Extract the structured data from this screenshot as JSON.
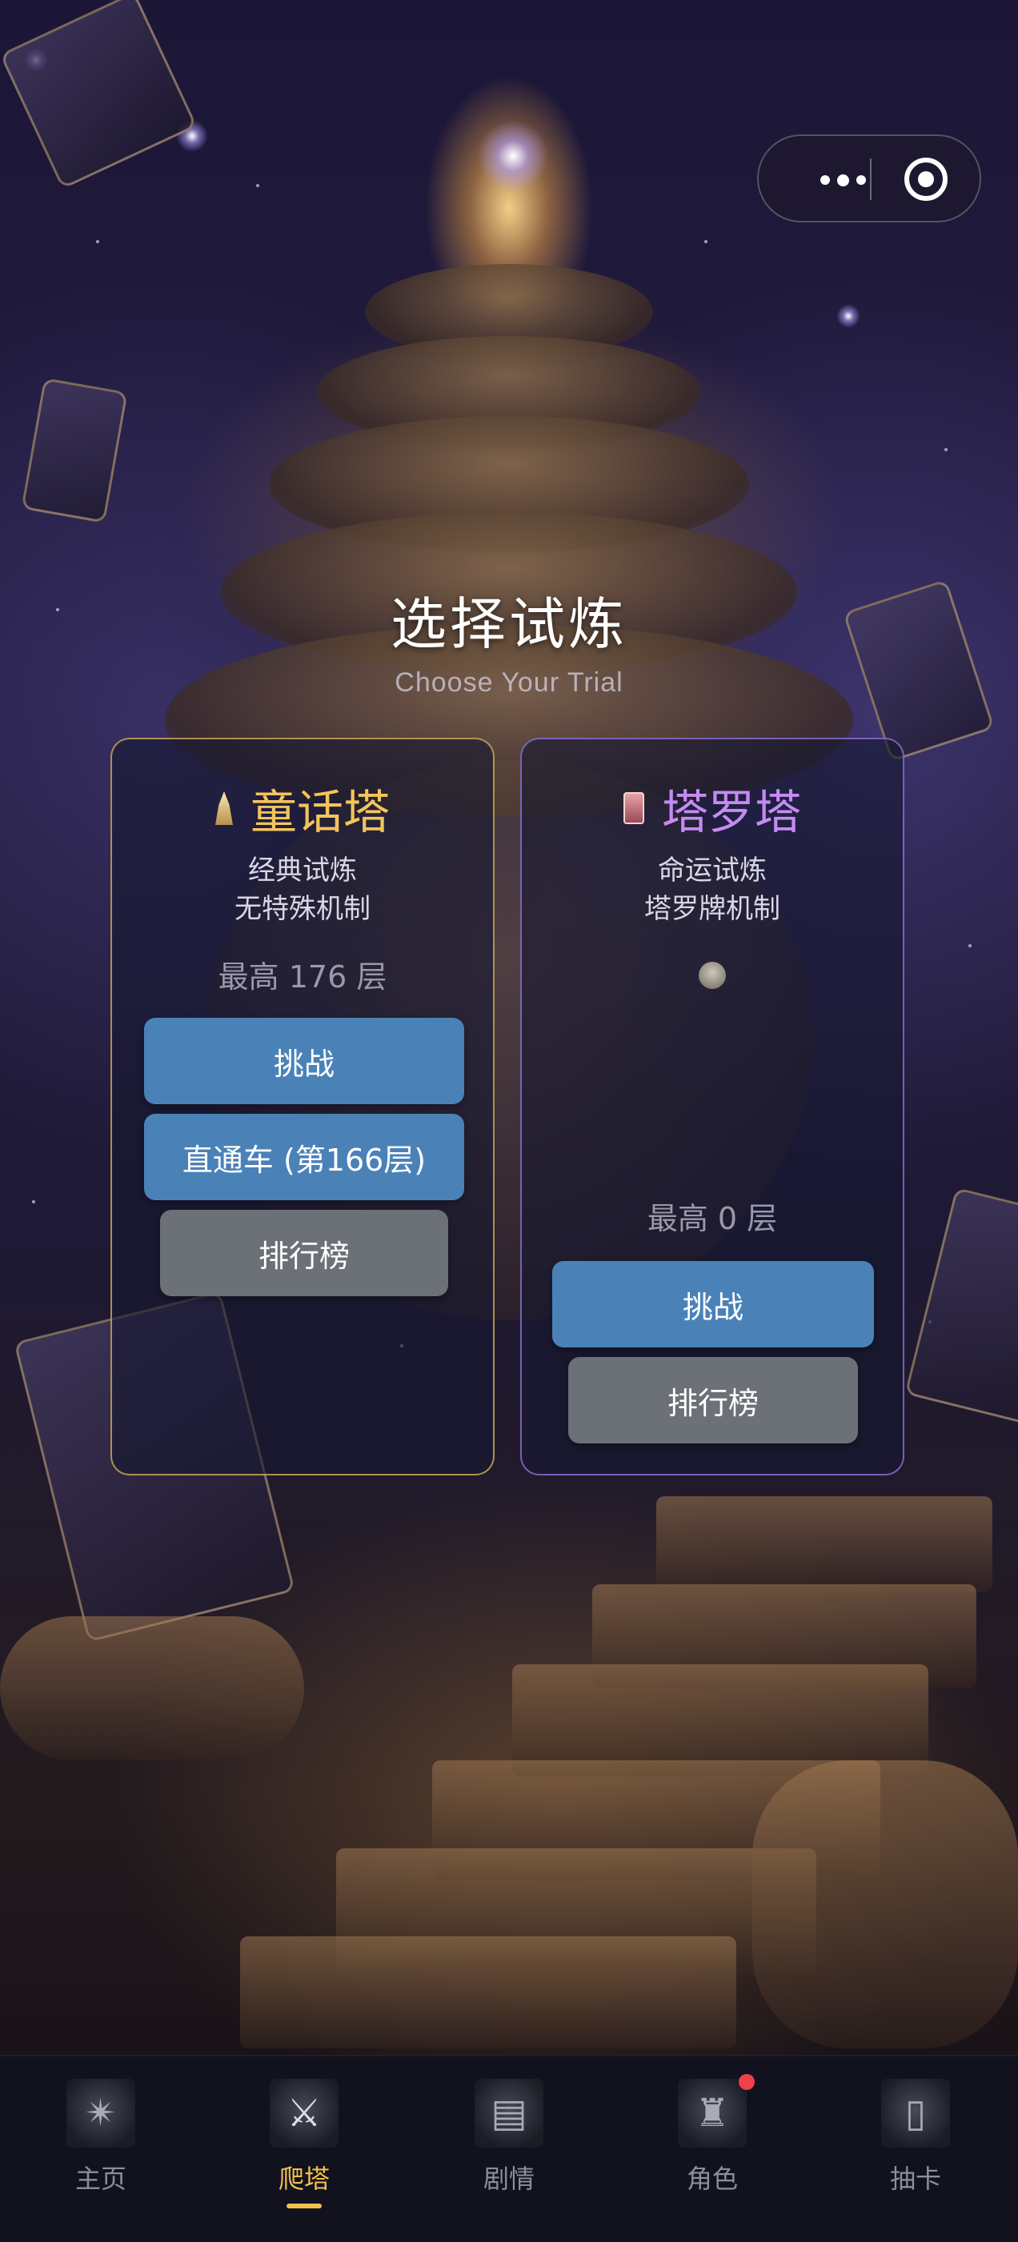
{
  "header": {
    "title": "选择试炼",
    "subtitle": "Choose Your Trial",
    "more_icon": "more-dots-icon",
    "close_icon": "target-icon"
  },
  "towers": [
    {
      "name": "童话塔",
      "icon": "tower-icon",
      "desc1": "经典试炼",
      "desc2": "无特殊机制",
      "best": "最高 176 层",
      "buttons": {
        "challenge": "挑战",
        "express": "直通车 (第166层)",
        "ranking": "排行榜"
      },
      "accent": "#f4c45a"
    },
    {
      "name": "塔罗塔",
      "icon": "tarot-card-icon",
      "desc1": "命运试炼",
      "desc2": "塔罗牌机制",
      "best": "最高 0 层",
      "buttons": {
        "challenge": "挑战",
        "ranking": "排行榜"
      },
      "accent": "#c58bf2"
    }
  ],
  "tabs": [
    {
      "label": "主页",
      "icon": "compass-icon"
    },
    {
      "label": "爬塔",
      "icon": "crossed-swords-icon",
      "active": true
    },
    {
      "label": "剧情",
      "icon": "book-icon"
    },
    {
      "label": "角色",
      "icon": "hooded-figure-icon",
      "badge": true
    },
    {
      "label": "抽卡",
      "icon": "card-deck-icon"
    }
  ],
  "colors": {
    "button_blue": "#4a82b8",
    "button_gray": "#6c7077",
    "active_tab": "#f1c04e",
    "badge": "#f0404a"
  }
}
